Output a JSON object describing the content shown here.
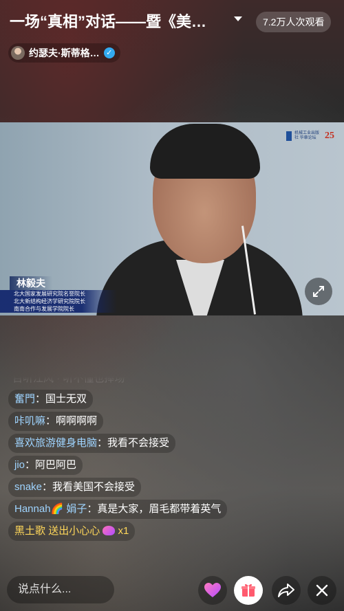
{
  "header": {
    "title": "一场“真相”对话——暨《美…",
    "viewers": "7.2万人次观看",
    "author_name": "约瑟夫·斯蒂格…"
  },
  "video": {
    "logo_text": "机械工业出版社 华章论坛",
    "logo_number": "25",
    "caption_name": "林毅夫",
    "caption_lines": [
      "北大国家发展研究院名誉院长",
      "北大新结构经济学研究院院长",
      "南南合作与发展学院院长"
    ]
  },
  "comments": {
    "faded": "百听江风 · 听不懂也捧场",
    "items": [
      {
        "user": "奮門",
        "text": "国士无双"
      },
      {
        "user": "咔叽嘛",
        "text": "啊啊啊啊"
      },
      {
        "user": "喜欢旅游健身电脑",
        "text": "我看不会接受"
      },
      {
        "user": "jio",
        "text": "阿巴阿巴"
      },
      {
        "user": "snake",
        "text": "我看美国不会接受"
      },
      {
        "user": "Hannah🌈 娟子",
        "text": "真是大家，眉毛都带着英气"
      }
    ],
    "gift": {
      "user": "黑土歌",
      "action": "送出小心心",
      "count": "x1"
    }
  },
  "bottom": {
    "input_placeholder": "说点什么..."
  },
  "icons": [
    "verified-icon",
    "chevron-down-icon",
    "fullscreen-icon",
    "heart-icon",
    "gift-icon",
    "share-icon",
    "close-icon"
  ],
  "colors": {
    "username": "#9fd4ff",
    "gift": "#ffd75a",
    "verified": "#33aaf0"
  }
}
